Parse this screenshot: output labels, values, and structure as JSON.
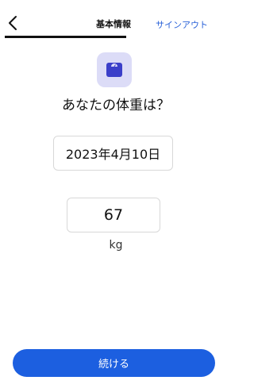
{
  "header": {
    "title": "基本情報",
    "signout_label": "サインアウト",
    "back_icon": "chevron-left-icon",
    "progress": 0.5
  },
  "question": {
    "icon": "scale-icon",
    "text": "あなたの体重は？"
  },
  "date_field": {
    "value": "2023年4月10日"
  },
  "weight_field": {
    "value": "67",
    "unit": "kg"
  },
  "continue_button": {
    "label": "続ける"
  },
  "colors": {
    "accent": "#1c5fe0",
    "link": "#2a62d8",
    "icon_bg": "#dcdcf7",
    "icon_fg": "#3b3fc9"
  }
}
